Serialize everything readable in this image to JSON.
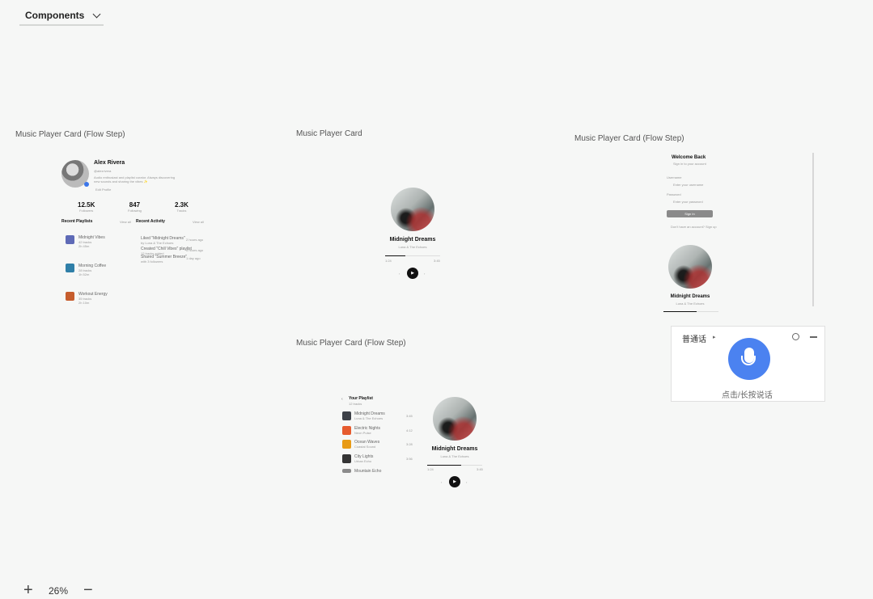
{
  "toolbar": {
    "dropdown_label": "Components"
  },
  "frames": [
    "Music Player Card (Flow Step)",
    "Music Player Card",
    "Music Player Card (Flow Step)",
    "Music Player Card (Flow Step)"
  ],
  "profile": {
    "name": "Alex Rivera",
    "handle": "@alexrivera",
    "bio_line1": "Audio enthusiast and playlist curator. Always discovering",
    "bio_line2": "new sounds and sharing the vibes ✨",
    "edit_label": "Edit Profile",
    "stats": [
      {
        "value": "12.5K",
        "label": "Followers"
      },
      {
        "value": "847",
        "label": "Following"
      },
      {
        "value": "2.3K",
        "label": "Tracks"
      }
    ],
    "recent_playlists_title": "Recent Playlists",
    "recent_playlists_action": "View all",
    "recent_activity_title": "Recent Activity",
    "recent_activity_action": "View all",
    "playlists": [
      {
        "title": "Midnight Vibes",
        "sub1": "42 tracks",
        "sub2": "2h 45m",
        "color": "#5e6ab6"
      },
      {
        "title": "Morning Coffee",
        "sub1": "28 tracks",
        "sub2": "1h 52m",
        "color": "#2f7fa8"
      },
      {
        "title": "Workout Energy",
        "sub1": "35 tracks",
        "sub2": "2h 10m",
        "color": "#c65d2d"
      }
    ],
    "activities": [
      {
        "text": "Liked \"Midnight Dreams\"",
        "sub": "by Luna & The Echoes",
        "time": "2 hours ago"
      },
      {
        "text": "Created \"Chill Vibes\" playlist",
        "sub": "12 tracks added",
        "time": "5 hours ago"
      },
      {
        "text": "Shared \"Summer Breeze\"",
        "sub": "with 3 followers",
        "time": "1 day ago"
      }
    ]
  },
  "player": {
    "title": "Midnight Dreams",
    "artist": "Luna & The Echoes",
    "current": "1:24",
    "duration": "3:45",
    "progress": 0.37
  },
  "login": {
    "title": "Welcome Back",
    "subtitle": "Sign in to your account",
    "username_label": "Username",
    "username_placeholder": "Enter your username",
    "password_label": "Password",
    "password_placeholder": "Enter your password",
    "button_label": "Sign In",
    "footer": "Don't have an account? Sign up"
  },
  "queue": {
    "title": "Your Playlist",
    "count": "12 tracks",
    "items": [
      {
        "title": "Midnight Dreams",
        "artist": "Luna & The Echoes",
        "time": "3:45",
        "color": "#3d4148"
      },
      {
        "title": "Electric Nights",
        "artist": "Neon Pulse",
        "time": "4:12",
        "color": "#e65b2e"
      },
      {
        "title": "Ocean Waves",
        "artist": "Coastal Sound",
        "time": "3:28",
        "color": "#e89b16"
      },
      {
        "title": "City Lights",
        "artist": "Urban Echo",
        "time": "3:56",
        "color": "#343434"
      },
      {
        "title": "Mountain Echo",
        "artist": "Highland Band",
        "time": "4:05",
        "color": "#8b8b8b"
      }
    ]
  },
  "voice": {
    "label": "普通话",
    "hint": "点击/长按说话"
  },
  "zoom": {
    "plus": "+",
    "level": "26%",
    "minus": "−"
  }
}
